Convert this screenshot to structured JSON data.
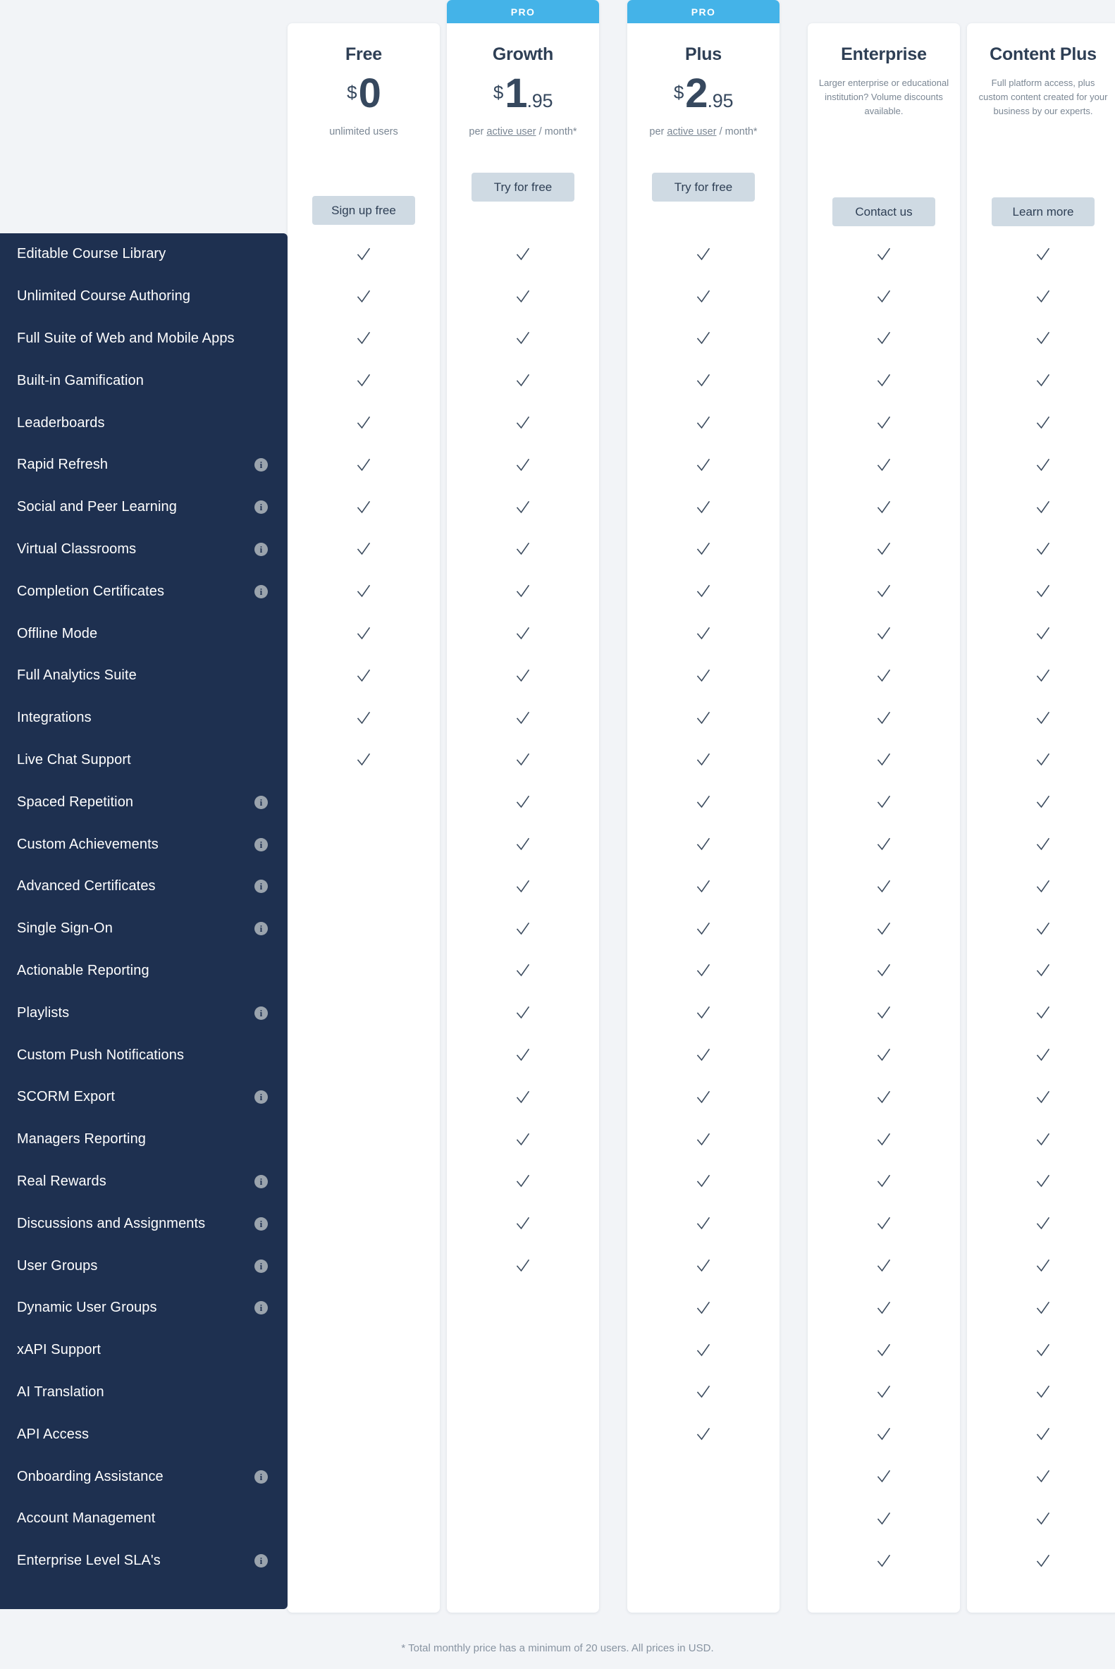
{
  "plans": [
    {
      "id": "free",
      "name": "Free",
      "promo": false,
      "promo_label": "",
      "currency": "$",
      "amount": "0",
      "cents": "",
      "price_sub_pre": "unlimited users",
      "price_sub_link": "",
      "price_sub_post": "",
      "description": "",
      "cta": "Sign up free"
    },
    {
      "id": "growth",
      "name": "Growth",
      "promo": true,
      "promo_label": "PRO",
      "currency": "$",
      "amount": "1",
      "cents": ".95",
      "price_sub_pre": "per ",
      "price_sub_link": "active user",
      "price_sub_post": " / month*",
      "description": "",
      "cta": "Try for free"
    },
    {
      "id": "plus",
      "name": "Plus",
      "promo": true,
      "promo_label": "PRO",
      "currency": "$",
      "amount": "2",
      "cents": ".95",
      "price_sub_pre": "per ",
      "price_sub_link": "active user",
      "price_sub_post": " / month*",
      "description": "",
      "cta": "Try for free"
    },
    {
      "id": "enterprise",
      "name": "Enterprise",
      "promo": false,
      "promo_label": "",
      "currency": "",
      "amount": "",
      "cents": "",
      "price_sub_pre": "",
      "price_sub_link": "",
      "price_sub_post": "",
      "description": "Larger enterprise or educational institution? Volume discounts available.",
      "cta": "Contact us"
    },
    {
      "id": "content-plus",
      "name": "Content Plus",
      "promo": false,
      "promo_label": "",
      "currency": "",
      "amount": "",
      "cents": "",
      "price_sub_pre": "",
      "price_sub_link": "",
      "price_sub_post": "",
      "description": "Full platform access, plus custom content created for your business by our experts.",
      "cta": "Learn more"
    }
  ],
  "features": [
    {
      "label": "Editable Course Library",
      "info": false,
      "checks": [
        true,
        true,
        true,
        true,
        true
      ]
    },
    {
      "label": "Unlimited Course Authoring",
      "info": false,
      "checks": [
        true,
        true,
        true,
        true,
        true
      ]
    },
    {
      "label": "Full Suite of Web and Mobile Apps",
      "info": false,
      "checks": [
        true,
        true,
        true,
        true,
        true
      ]
    },
    {
      "label": "Built-in Gamification",
      "info": false,
      "checks": [
        true,
        true,
        true,
        true,
        true
      ]
    },
    {
      "label": "Leaderboards",
      "info": false,
      "checks": [
        true,
        true,
        true,
        true,
        true
      ]
    },
    {
      "label": "Rapid Refresh",
      "info": true,
      "checks": [
        true,
        true,
        true,
        true,
        true
      ]
    },
    {
      "label": "Social and Peer Learning",
      "info": true,
      "checks": [
        true,
        true,
        true,
        true,
        true
      ]
    },
    {
      "label": "Virtual Classrooms",
      "info": true,
      "checks": [
        true,
        true,
        true,
        true,
        true
      ]
    },
    {
      "label": "Completion Certificates",
      "info": true,
      "checks": [
        true,
        true,
        true,
        true,
        true
      ]
    },
    {
      "label": "Offline Mode",
      "info": false,
      "checks": [
        true,
        true,
        true,
        true,
        true
      ]
    },
    {
      "label": "Full Analytics Suite",
      "info": false,
      "checks": [
        true,
        true,
        true,
        true,
        true
      ]
    },
    {
      "label": "Integrations",
      "info": false,
      "checks": [
        true,
        true,
        true,
        true,
        true
      ]
    },
    {
      "label": "Live Chat Support",
      "info": false,
      "checks": [
        true,
        true,
        true,
        true,
        true
      ]
    },
    {
      "label": "Spaced Repetition",
      "info": true,
      "checks": [
        false,
        true,
        true,
        true,
        true
      ]
    },
    {
      "label": "Custom Achievements",
      "info": true,
      "checks": [
        false,
        true,
        true,
        true,
        true
      ]
    },
    {
      "label": "Advanced Certificates",
      "info": true,
      "checks": [
        false,
        true,
        true,
        true,
        true
      ]
    },
    {
      "label": "Single Sign-On",
      "info": true,
      "checks": [
        false,
        true,
        true,
        true,
        true
      ]
    },
    {
      "label": "Actionable Reporting",
      "info": false,
      "checks": [
        false,
        true,
        true,
        true,
        true
      ]
    },
    {
      "label": "Playlists",
      "info": true,
      "checks": [
        false,
        true,
        true,
        true,
        true
      ]
    },
    {
      "label": "Custom Push Notifications",
      "info": false,
      "checks": [
        false,
        true,
        true,
        true,
        true
      ]
    },
    {
      "label": "SCORM Export",
      "info": true,
      "checks": [
        false,
        true,
        true,
        true,
        true
      ]
    },
    {
      "label": "Managers Reporting",
      "info": false,
      "checks": [
        false,
        true,
        true,
        true,
        true
      ]
    },
    {
      "label": "Real Rewards",
      "info": true,
      "checks": [
        false,
        true,
        true,
        true,
        true
      ]
    },
    {
      "label": "Discussions and Assignments",
      "info": true,
      "checks": [
        false,
        true,
        true,
        true,
        true
      ]
    },
    {
      "label": "User Groups",
      "info": true,
      "checks": [
        false,
        true,
        true,
        true,
        true
      ]
    },
    {
      "label": "Dynamic User Groups",
      "info": true,
      "checks": [
        false,
        false,
        true,
        true,
        true
      ]
    },
    {
      "label": "xAPI Support",
      "info": false,
      "checks": [
        false,
        false,
        true,
        true,
        true
      ]
    },
    {
      "label": "AI Translation",
      "info": false,
      "checks": [
        false,
        false,
        true,
        true,
        true
      ]
    },
    {
      "label": "API Access",
      "info": false,
      "checks": [
        false,
        false,
        true,
        true,
        true
      ]
    },
    {
      "label": "Onboarding Assistance",
      "info": true,
      "checks": [
        false,
        false,
        false,
        true,
        true
      ]
    },
    {
      "label": "Account Management",
      "info": false,
      "checks": [
        false,
        false,
        false,
        true,
        true
      ]
    },
    {
      "label": "Enterprise Level SLA's",
      "info": true,
      "checks": [
        false,
        false,
        false,
        true,
        true
      ]
    }
  ],
  "footnote": "* Total monthly price has a minimum of 20 users. All prices in USD.",
  "icons": {
    "info": "i",
    "check": "check-icon"
  },
  "colors": {
    "accent": "#44b3e8",
    "sidebar_bg": "#1e3050",
    "page_bg": "#f2f4f7",
    "cta_bg": "#cfdae3",
    "text_dark": "#2e3f55",
    "text_muted": "#7b8794"
  }
}
